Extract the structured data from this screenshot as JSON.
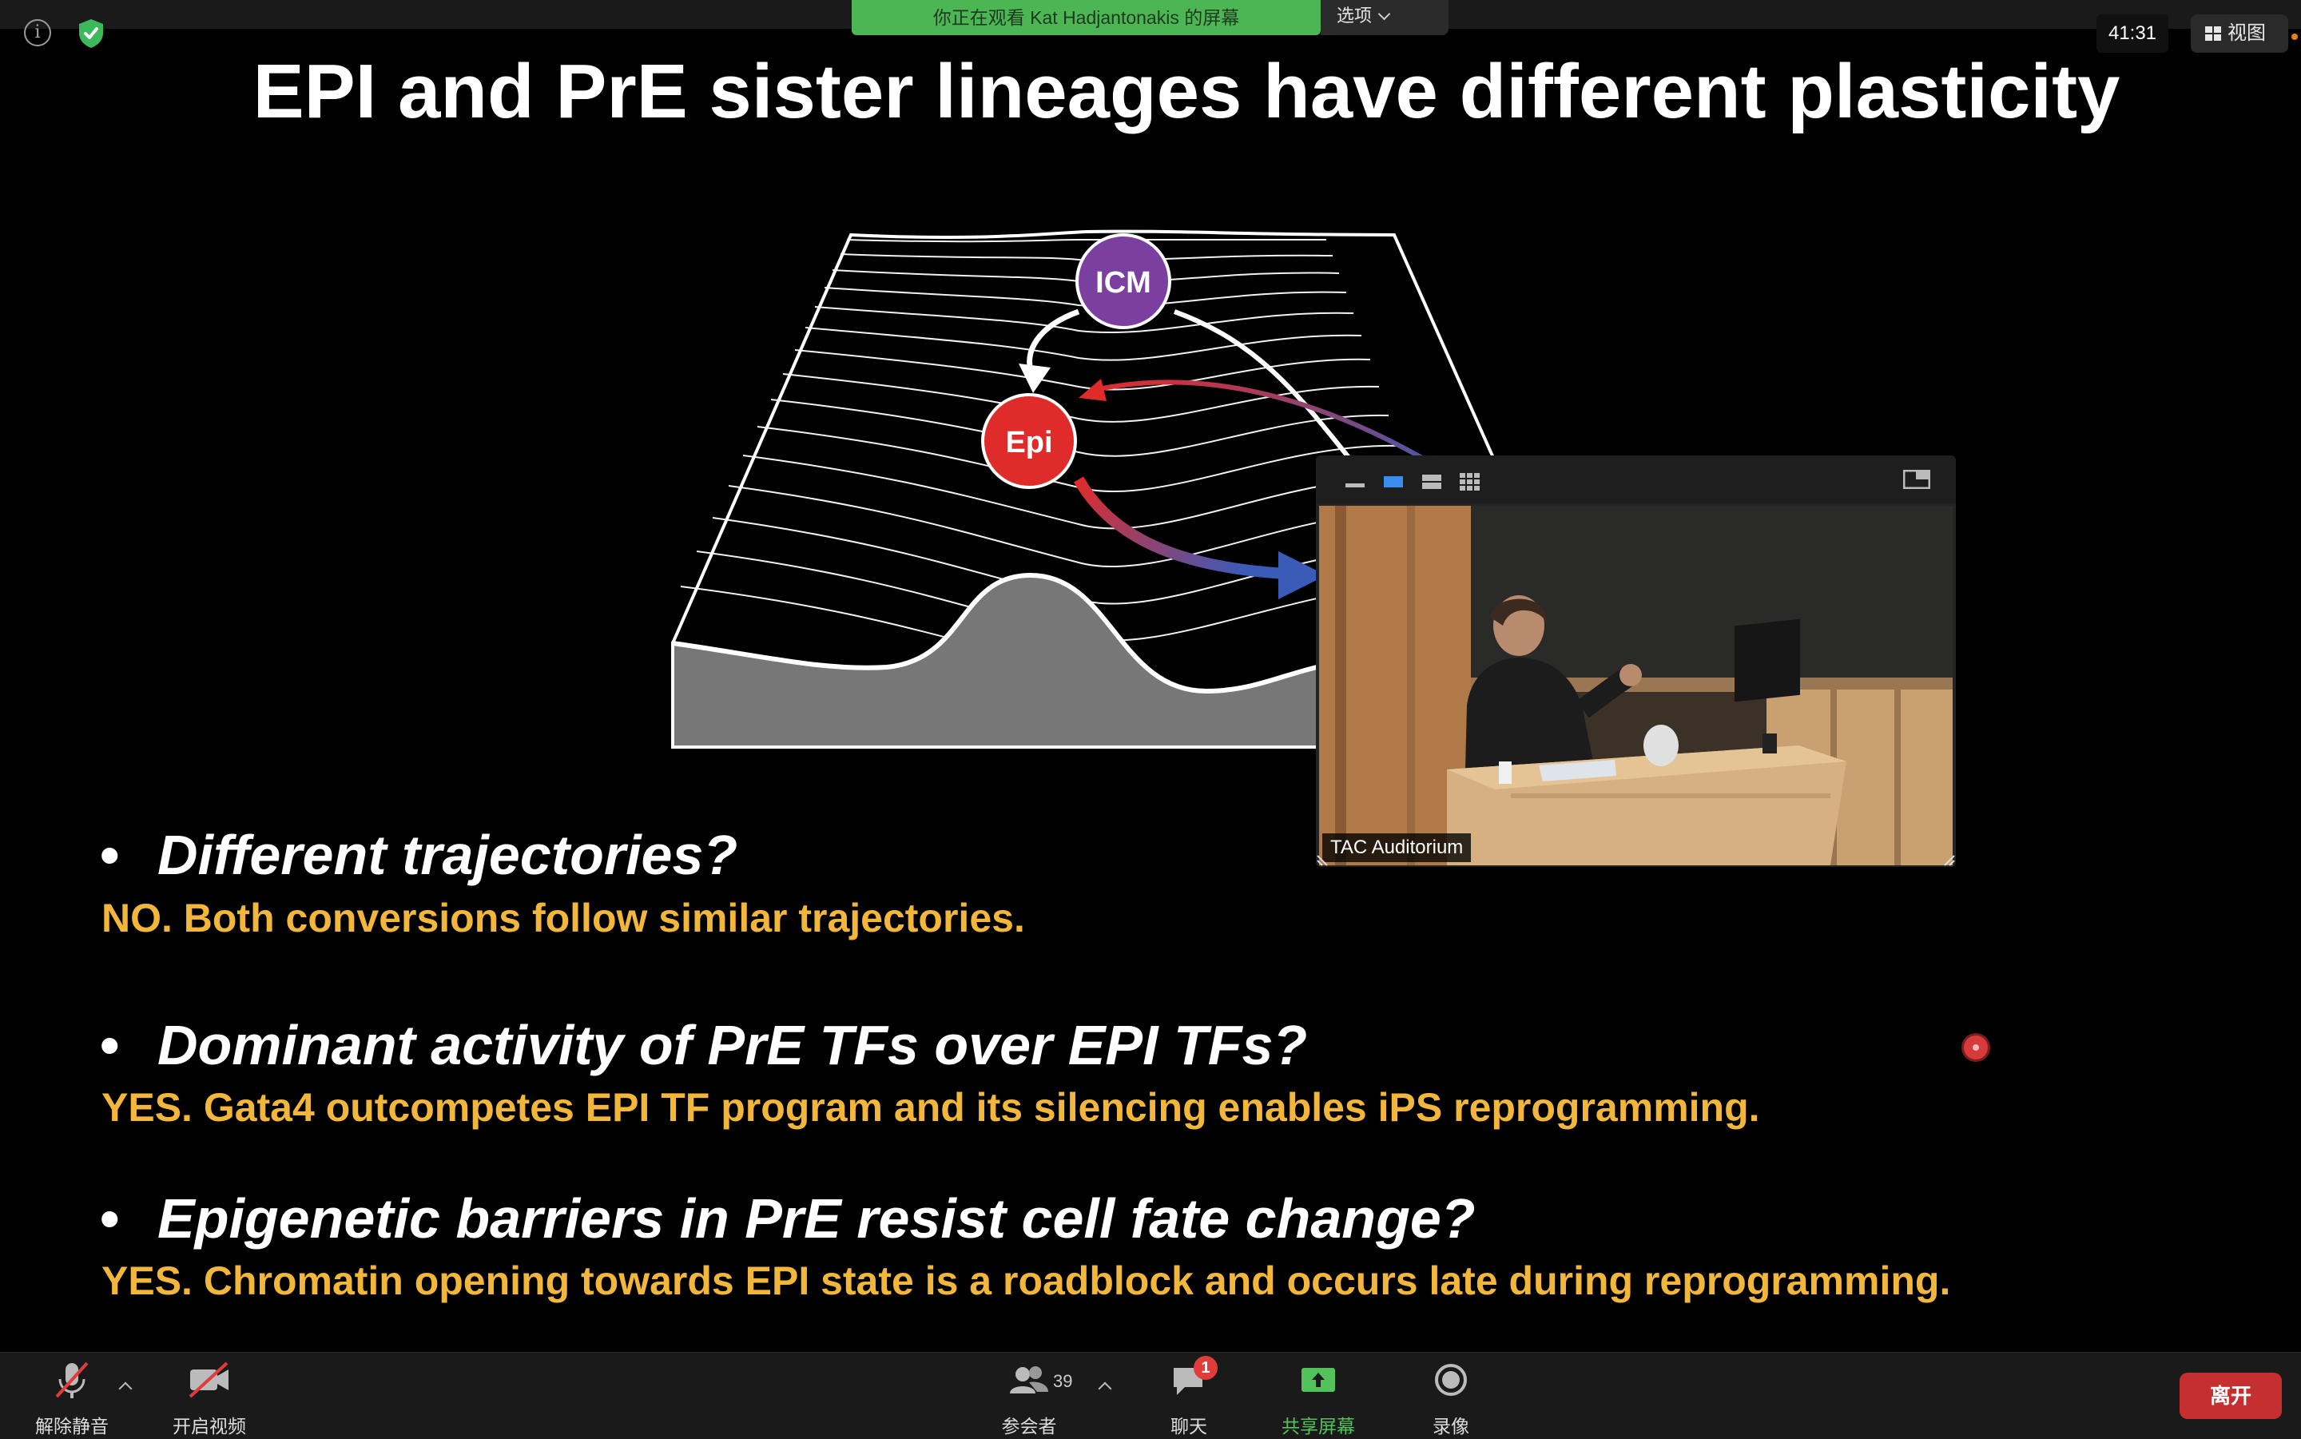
{
  "window": {
    "share_banner": "你正在观看 Kat Hadjantonakis 的屏幕",
    "options_label": "选项",
    "timer": "41:31",
    "view_label": "视图"
  },
  "slide": {
    "title": "EPI and PrE sister lineages have different plasticity",
    "diagram_labels": {
      "icm": "ICM",
      "epi": "Epi"
    },
    "bullets": [
      {
        "question": "Different trajectories?",
        "answer": "NO. Both conversions follow similar trajectories."
      },
      {
        "question": "Dominant activity of PrE TFs over EPI TFs?",
        "answer": "YES. Gata4 outcompetes EPI TF program and its silencing enables iPS reprogramming."
      },
      {
        "question": "Epigenetic barriers in PrE resist cell fate change?",
        "answer": "YES. Chromatin opening towards EPI state is a roadblock and occurs late during reprogramming."
      }
    ],
    "colors": {
      "answer": "#f2b73a",
      "icm": "#7b3fa0",
      "epi": "#e02b2b"
    }
  },
  "video": {
    "participant_name": "TAC Auditorium",
    "toolbar_icons": [
      "minimize-icon",
      "single-view-icon",
      "strip-view-icon",
      "grid-view-icon",
      "exit-floating-icon"
    ]
  },
  "toolbar": {
    "unmute": "解除静音",
    "start_video": "开启视频",
    "participants": "参会者",
    "participant_count": "39",
    "chat": "聊天",
    "chat_badge": "1",
    "share_screen": "共享屏幕",
    "record": "录像",
    "leave": "离开"
  }
}
